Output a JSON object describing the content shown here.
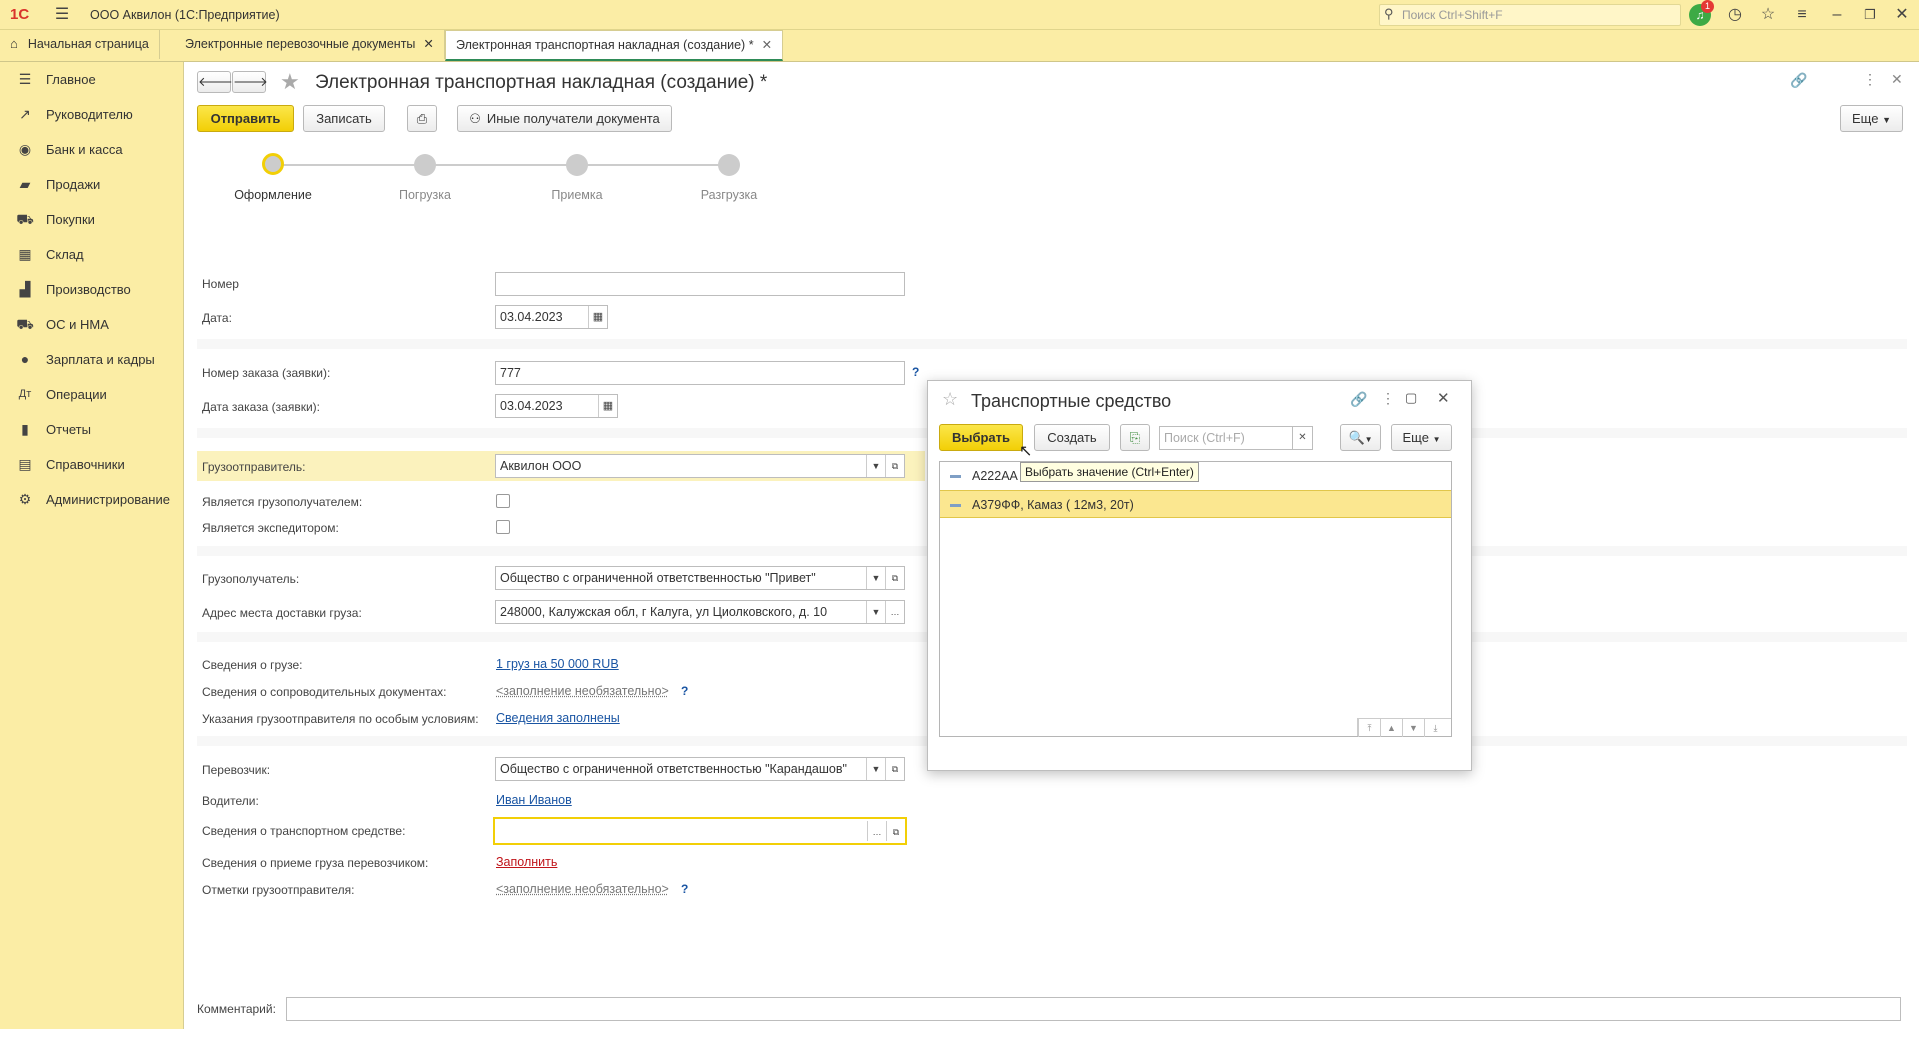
{
  "app": {
    "title": "ООО Аквилон  (1С:Предприятие)",
    "logo": "1С",
    "search_placeholder": "Поиск Ctrl+Shift+F",
    "notif_count": "1"
  },
  "tabs": [
    {
      "label": "Начальная страница"
    },
    {
      "label": "Электронные перевозочные документы"
    },
    {
      "label": "Электронная транспортная накладная (создание) *"
    }
  ],
  "sidebar": {
    "items": [
      {
        "label": "Главное",
        "icon": "menu-icon"
      },
      {
        "label": "Руководителю",
        "icon": "chart-trend-icon"
      },
      {
        "label": "Банк и касса",
        "icon": "coins-icon"
      },
      {
        "label": "Продажи",
        "icon": "bag-icon"
      },
      {
        "label": "Покупки",
        "icon": "cart-icon"
      },
      {
        "label": "Склад",
        "icon": "warehouse-icon"
      },
      {
        "label": "Производство",
        "icon": "factory-icon"
      },
      {
        "label": "ОС и НМА",
        "icon": "truck-icon"
      },
      {
        "label": "Зарплата и кадры",
        "icon": "person-icon"
      },
      {
        "label": "Операции",
        "icon": "operations-icon"
      },
      {
        "label": "Отчеты",
        "icon": "bar-chart-icon"
      },
      {
        "label": "Справочники",
        "icon": "book-icon"
      },
      {
        "label": "Администрирование",
        "icon": "gear-icon"
      }
    ]
  },
  "form": {
    "title": "Электронная транспортная накладная (создание) *",
    "send_label": "Отправить",
    "save_label": "Записать",
    "other_recipients_label": "Иные получатели документа",
    "more_label": "Еще",
    "steps": [
      "Оформление",
      "Погрузка",
      "Приемка",
      "Разгрузка"
    ],
    "active_step": "Оформление",
    "fields": {
      "number_label": "Номер",
      "number_value": "",
      "date_label": "Дата:",
      "date_value": "03.04.2023",
      "order_number_label": "Номер заказа (заявки):",
      "order_number_value": "777",
      "order_date_label": "Дата заказа (заявки):",
      "order_date_value": "03.04.2023",
      "shipper_label": "Грузоотправитель:",
      "shipper_value": "Аквилон ООО",
      "is_consignee_label": "Является грузополучателем:",
      "is_forwarder_label": "Является экспедитором:",
      "consignee_label": "Грузополучатель:",
      "consignee_value": "Общество с ограниченной ответственностью \"Привет\"",
      "delivery_address_label": "Адрес места доставки груза:",
      "delivery_address_value": "248000, Калужская обл, г Калуга, ул Циолковского, д. 10",
      "cargo_info_label": "Сведения о грузе:",
      "cargo_info_value": "1 груз на 50 000 RUB",
      "docs_label": "Сведения о сопроводительных документах:",
      "docs_value": "<заполнение необязательно>",
      "special_label": "Указания грузоотправителя по особым условиям:",
      "special_value": "Сведения заполнены",
      "carrier_label": "Перевозчик:",
      "carrier_value": "Общество с ограниченной ответственностью \"Карандашов\"",
      "drivers_label": "Водители:",
      "drivers_value": "Иван Иванов",
      "vehicle_label": "Сведения о транспортном средстве:",
      "vehicle_value": "",
      "acceptance_label": "Сведения о приеме груза перевозчиком:",
      "acceptance_value": "Заполнить",
      "marks_label": "Отметки грузоотправителя:",
      "marks_value": "<заполнение необязательно>",
      "comment_label": "Комментарий:",
      "comment_value": ""
    }
  },
  "dialog": {
    "title": "Транспортные средство",
    "select_label": "Выбрать",
    "create_label": "Создать",
    "search_placeholder": "Поиск (Ctrl+F)",
    "more_label": "Еще",
    "tooltip": "Выбрать значение (Ctrl+Enter)",
    "rows": [
      {
        "label": "А222АА"
      },
      {
        "label": "А379ФФ, Камаз ( 12м3, 20т)"
      }
    ]
  }
}
